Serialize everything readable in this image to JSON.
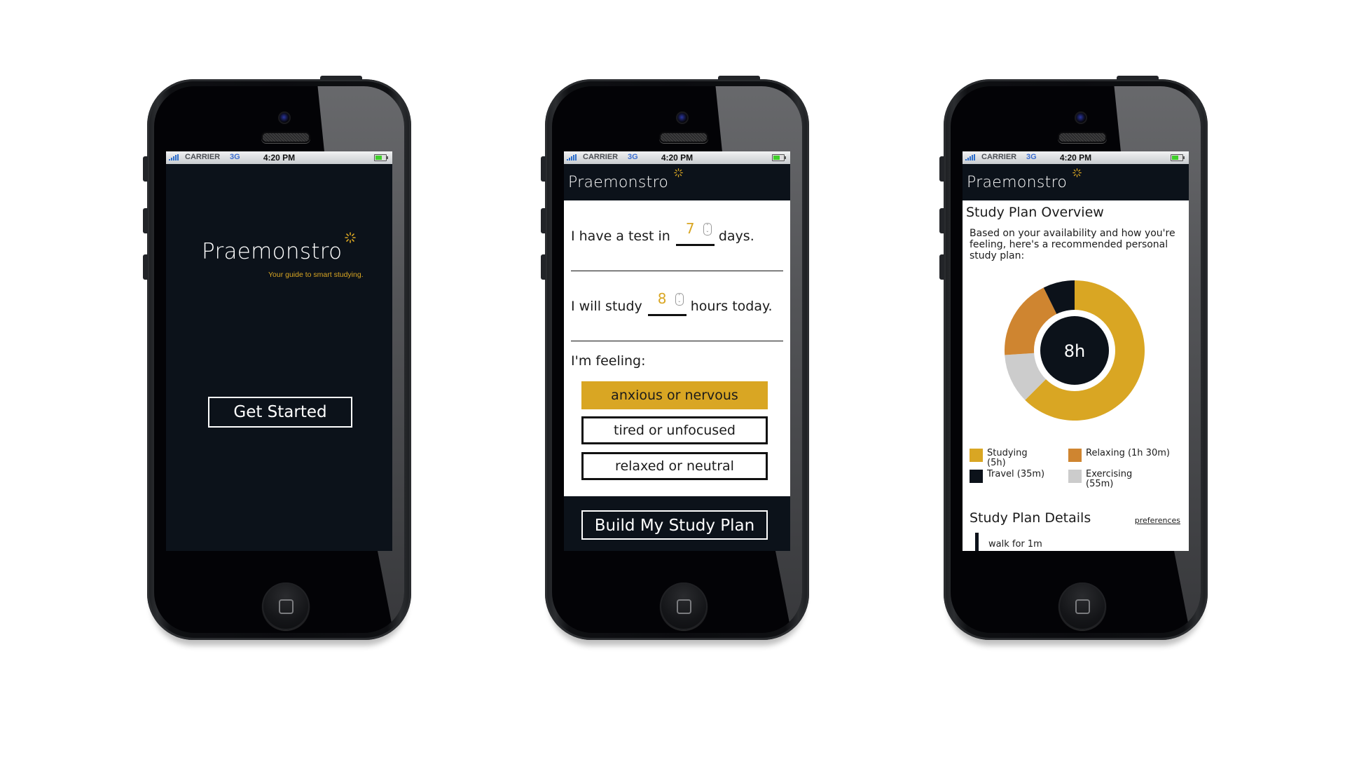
{
  "status_bar": {
    "carrier": "CARRIER",
    "network": "3G",
    "time": "4:20 PM"
  },
  "brand": {
    "name": "Praemonstro",
    "tagline": "Your guide to smart studying.",
    "accent_color": "#d9a623",
    "dark_color": "#0c121a"
  },
  "screen_welcome": {
    "get_started_label": "Get Started"
  },
  "screen_input": {
    "test_prefix": "I have a test in",
    "test_days_value": "7",
    "test_suffix": "days.",
    "study_prefix": "I will study",
    "study_hours_value": "8",
    "study_suffix": "hours today.",
    "feeling_label": "I'm feeling:",
    "feelings": [
      {
        "label": "anxious or nervous",
        "selected": true
      },
      {
        "label": "tired or unfocused",
        "selected": false
      },
      {
        "label": "relaxed or neutral",
        "selected": false
      }
    ],
    "build_label": "Build My Study Plan"
  },
  "screen_overview": {
    "title": "Study Plan Overview",
    "description": "Based on your availability and how you're feeling, here's a recommended personal study plan:",
    "center_label": "8h",
    "details_title": "Study Plan Details",
    "preferences_link": "preferences",
    "first_item": "walk for 1m"
  },
  "chart_data": {
    "type": "pie",
    "title": "Study Plan Overview",
    "center_label": "8h",
    "unit": "minutes",
    "slices": [
      {
        "name": "Studying",
        "label": "Studying (5h)",
        "value": 300,
        "color": "#d9a623"
      },
      {
        "name": "Exercising",
        "label": "Exercising (55m)",
        "value": 55,
        "color": "#cccccc"
      },
      {
        "name": "Relaxing",
        "label": "Relaxing (1h 30m)",
        "value": 90,
        "color": "#cf8530"
      },
      {
        "name": "Travel",
        "label": "Travel (35m)",
        "value": 35,
        "color": "#0c121a"
      }
    ],
    "legend_placement": "bottom"
  }
}
